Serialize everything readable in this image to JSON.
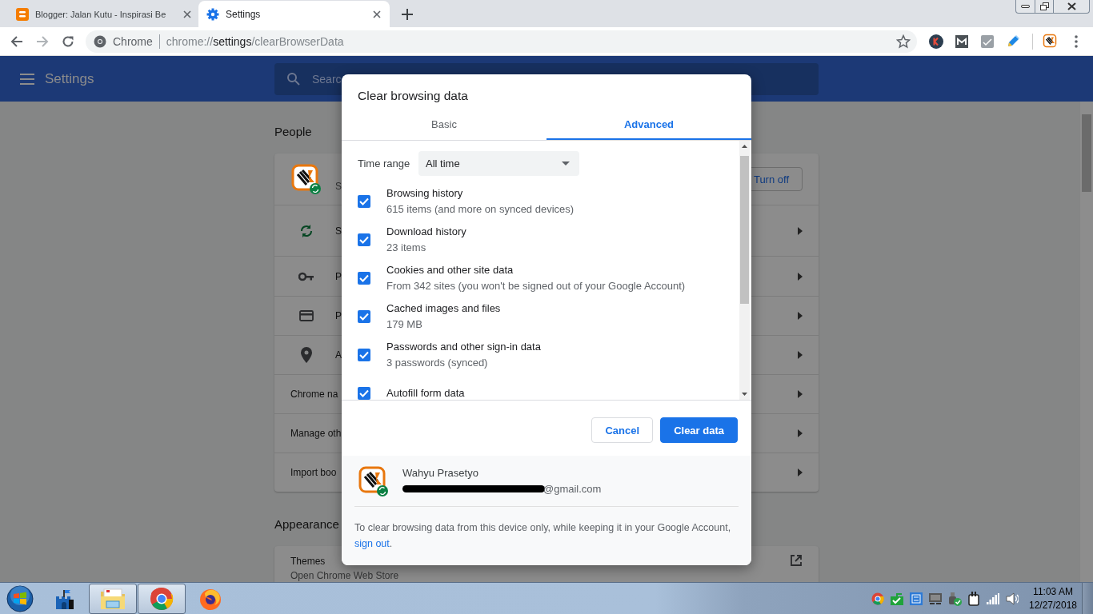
{
  "browser": {
    "tabs": [
      {
        "title": "Blogger: Jalan Kutu - Inspirasi Be",
        "selected": false
      },
      {
        "title": "Settings",
        "selected": true
      }
    ],
    "omnibox": {
      "site_label": "Chrome",
      "url_scheme": "chrome://",
      "url_host": "settings",
      "url_path": "/clearBrowserData"
    }
  },
  "settings_page": {
    "header_title": "Settings",
    "search_placeholder": "Searc",
    "sections": [
      {
        "title": "People",
        "rows": [
          {
            "kind": "profile",
            "subtitle": "S",
            "action": "Turn off"
          },
          {
            "kind": "icon",
            "title": "S"
          },
          {
            "kind": "icon",
            "title": "P"
          },
          {
            "kind": "icon",
            "title": "P"
          },
          {
            "kind": "icon",
            "title": "A"
          },
          {
            "kind": "plain",
            "title": "Chrome na"
          },
          {
            "kind": "plain",
            "title": "Manage oth"
          },
          {
            "kind": "plain",
            "title": "Import boo"
          }
        ]
      },
      {
        "title": "Appearance",
        "rows": [
          {
            "kind": "external",
            "title": "Themes",
            "subtitle": "Open Chrome Web Store"
          }
        ]
      }
    ]
  },
  "dialog": {
    "title": "Clear browsing data",
    "tabs": [
      {
        "label": "Basic",
        "selected": false
      },
      {
        "label": "Advanced",
        "selected": true
      }
    ],
    "time_range": {
      "label": "Time range",
      "value": "All time"
    },
    "items": [
      {
        "label": "Browsing history",
        "detail": "615 items (and more on synced devices)",
        "checked": true
      },
      {
        "label": "Download history",
        "detail": "23 items",
        "checked": true
      },
      {
        "label": "Cookies and other site data",
        "detail": "From 342 sites (you won't be signed out of your Google Account)",
        "checked": true
      },
      {
        "label": "Cached images and files",
        "detail": "179 MB",
        "checked": true
      },
      {
        "label": "Passwords and other sign-in data",
        "detail": "3 passwords (synced)",
        "checked": true
      },
      {
        "label": "Autofill form data",
        "checked": true
      }
    ],
    "buttons": {
      "cancel": "Cancel",
      "confirm": "Clear data"
    },
    "account": {
      "name": "Wahyu Prasetyo",
      "email_visible": "@gmail.com"
    },
    "note": {
      "text": "To clear browsing data from this device only, while keeping it in your Google Account,",
      "link": "sign out",
      "end": "."
    }
  },
  "taskbar": {
    "apps": [
      {
        "running": false
      },
      {
        "running": true
      },
      {
        "running": true
      },
      {
        "running": false
      }
    ],
    "clock": {
      "time": "11:03 AM",
      "date": "12/27/2018"
    }
  }
}
